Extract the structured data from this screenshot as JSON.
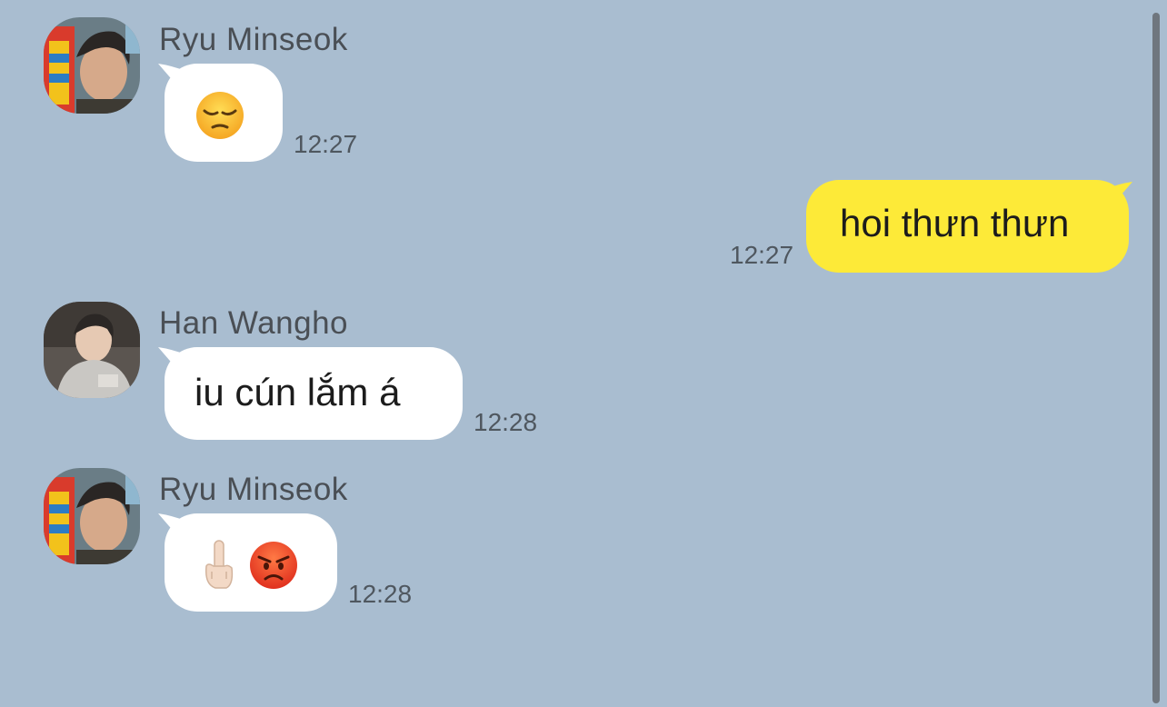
{
  "messages": [
    {
      "sender": "Ryu Minseok",
      "text": "😔",
      "time": "12:27",
      "direction": "incoming",
      "emoji": [
        "pensive-face"
      ]
    },
    {
      "sender": "",
      "text": "hoi thưn thưn",
      "time": "12:27",
      "direction": "outgoing"
    },
    {
      "sender": "Han Wangho",
      "text": "iu cún lắm á",
      "time": "12:28",
      "direction": "incoming"
    },
    {
      "sender": "Ryu Minseok",
      "text": "🖕🏻😡",
      "time": "12:28",
      "direction": "incoming",
      "emoji": [
        "middle-finger-light-skin",
        "pouting-face"
      ]
    }
  ],
  "colors": {
    "background": "#a9bdd0",
    "incoming_bubble": "#ffffff",
    "outgoing_bubble": "#fdea38",
    "timestamp": "#4f575f"
  }
}
